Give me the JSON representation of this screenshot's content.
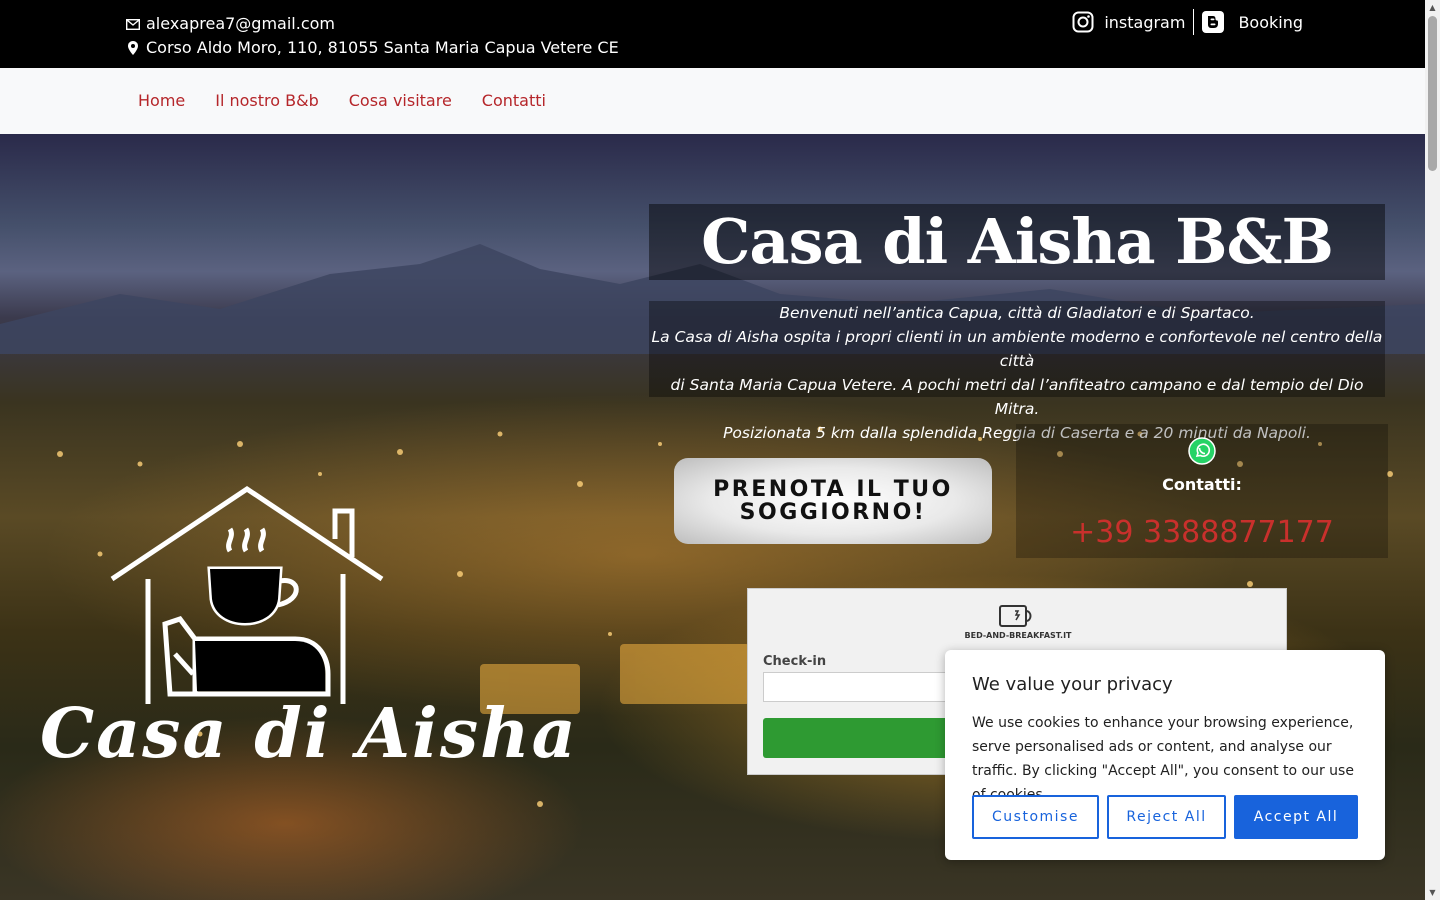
{
  "topbar": {
    "email": "alexaprea7@gmail.com",
    "address": "Corso Aldo Moro, 110, 81055 Santa Maria Capua Vetere CE",
    "instagram_label": "instagram",
    "booking_label": "Booking"
  },
  "nav": {
    "items": [
      "Home",
      "Il nostro B&b",
      "Cosa visitare",
      "Contatti"
    ]
  },
  "hero": {
    "title": "Casa di Aisha B&B",
    "desc_line1": "Benvenuti nell’antica Capua, città di Gladiatori e di Spartaco.",
    "desc_line2": "La Casa di Aisha ospita i propri clienti in un ambiente moderno e confortevole nel centro della città",
    "desc_line3": "di Santa Maria Capua Vetere. A pochi metri dal l’anfiteatro campano e dal tempio del Dio Mitra.",
    "desc_line4": "Posizionata 5 km dalla splendida Reggia di Caserta e a 20 minuti da Napoli.",
    "book_line1": "PRENOTA IL TUO",
    "book_line2": "SOGGIORNO!",
    "contatti_label": "Contatti:",
    "phone": "+39 3388877177",
    "logo_text": "Casa di Aisha"
  },
  "widget": {
    "brand": "BED-AND-BREAKFAST.IT",
    "checkin_label": "Check-in"
  },
  "cookie": {
    "title": "We value your privacy",
    "text": "We use cookies to enhance your browsing experience, serve personalised ads or content, and analyse our traffic. By clicking \"Accept All\", you consent to our use of cookies.",
    "customise": "Customise",
    "reject": "Reject All",
    "accept": "Accept All"
  },
  "colors": {
    "nav_link": "#b5262a",
    "phone": "#c9302c",
    "accent_blue": "#1863dc",
    "search_green": "#2e9a32"
  }
}
